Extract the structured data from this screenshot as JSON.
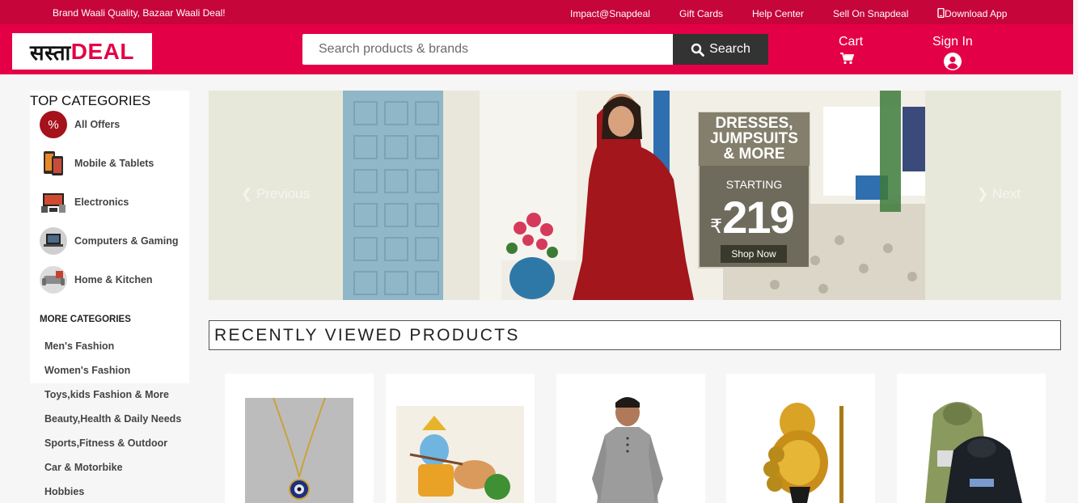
{
  "topbar": {
    "tagline": "Brand Waali Quality, Bazaar Waali Deal!",
    "links": [
      "Impact@Snapdeal",
      "Gift Cards",
      "Help Center",
      "Sell On Snapdeal",
      "Download App"
    ]
  },
  "header": {
    "logo_part1": "सस्ता",
    "logo_part2": "DEAL",
    "search_placeholder": "Search products & brands",
    "search_button": "Search",
    "cart_label": "Cart",
    "signin_label": "Sign In"
  },
  "sidebar": {
    "title": "TOP CATEGORIES",
    "categories": [
      "All Offers",
      "Mobile & Tablets",
      "Electronics",
      "Computers & Gaming",
      "Home & Kitchen"
    ],
    "more_title": "MORE CATEGORIES",
    "more": [
      "Men's Fashion",
      "Women's Fashion",
      "Toys,kids Fashion & More",
      "Beauty,Health & Daily Needs",
      "Sports,Fitness & Outdoor",
      "Car & Motorbike",
      "Hobbies"
    ]
  },
  "banner": {
    "prev": "Previous",
    "next": "Next",
    "headline": [
      "DRESSES,",
      "JUMPSUITS",
      "& MORE"
    ],
    "starting": "STARTING",
    "price": "219",
    "currency": "₹",
    "cta": "Shop Now"
  },
  "recent": {
    "title": "RECENTLY VIEWED PRODUCTS"
  },
  "colors": {
    "topbar": "#c6053b",
    "header": "#e40046",
    "search_button": "#333333"
  }
}
